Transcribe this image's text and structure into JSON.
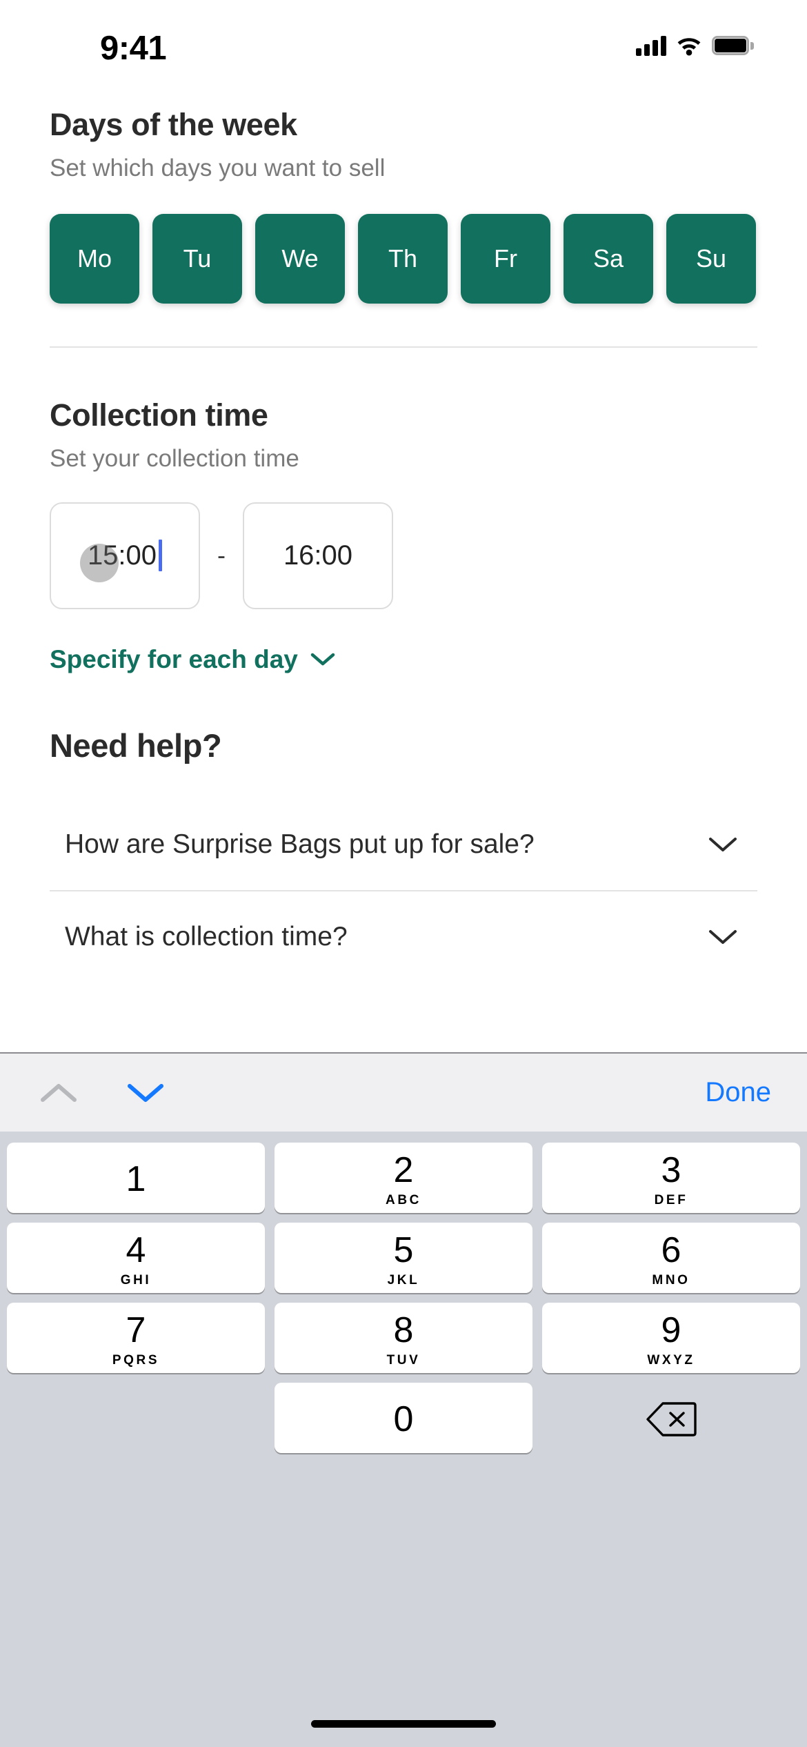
{
  "status_bar": {
    "time": "9:41",
    "signal_icon": "cellular-signal-icon",
    "wifi_icon": "wifi-icon",
    "battery_icon": "battery-full-icon"
  },
  "theme": {
    "brand_green": "#11715e",
    "link_blue": "#1479ff",
    "caret_blue": "#4a6cf0",
    "text_primary": "#2b2b2b",
    "text_secondary": "#7a7a7a",
    "keyboard_bg": "#d1d4da",
    "toolbar_bg": "#f0f0f2"
  },
  "days_section": {
    "title": "Days of the week",
    "subtitle": "Set which days you want to sell",
    "days": [
      {
        "label": "Mo",
        "selected": true
      },
      {
        "label": "Tu",
        "selected": true
      },
      {
        "label": "We",
        "selected": true
      },
      {
        "label": "Th",
        "selected": true
      },
      {
        "label": "Fr",
        "selected": true
      },
      {
        "label": "Sa",
        "selected": true
      },
      {
        "label": "Su",
        "selected": true
      }
    ]
  },
  "collection_section": {
    "title": "Collection time",
    "subtitle": "Set your collection time",
    "start_time": "15:00",
    "separator": "-",
    "end_time": "16:00",
    "specify_link": "Specify for each day",
    "specify_chevron_icon": "chevron-down-icon"
  },
  "help_section": {
    "title": "Need help?",
    "faqs": [
      {
        "question": "How are Surprise Bags put up for sale?",
        "chevron_icon": "chevron-down-icon"
      },
      {
        "question": "What is collection time?",
        "chevron_icon": "chevron-down-icon"
      }
    ]
  },
  "keyboard": {
    "toolbar": {
      "prev_icon": "chevron-up-icon",
      "next_icon": "chevron-down-icon",
      "done_label": "Done"
    },
    "rows": [
      [
        {
          "num": "1",
          "letters": ""
        },
        {
          "num": "2",
          "letters": "ABC"
        },
        {
          "num": "3",
          "letters": "DEF"
        }
      ],
      [
        {
          "num": "4",
          "letters": "GHI"
        },
        {
          "num": "5",
          "letters": "JKL"
        },
        {
          "num": "6",
          "letters": "MNO"
        }
      ],
      [
        {
          "num": "7",
          "letters": "PQRS"
        },
        {
          "num": "8",
          "letters": "TUV"
        },
        {
          "num": "9",
          "letters": "WXYZ"
        }
      ],
      [
        {
          "num": "",
          "letters": "",
          "blank": true
        },
        {
          "num": "0",
          "letters": ""
        },
        {
          "num": "",
          "letters": "",
          "delete_icon": "backspace-icon"
        }
      ]
    ]
  }
}
